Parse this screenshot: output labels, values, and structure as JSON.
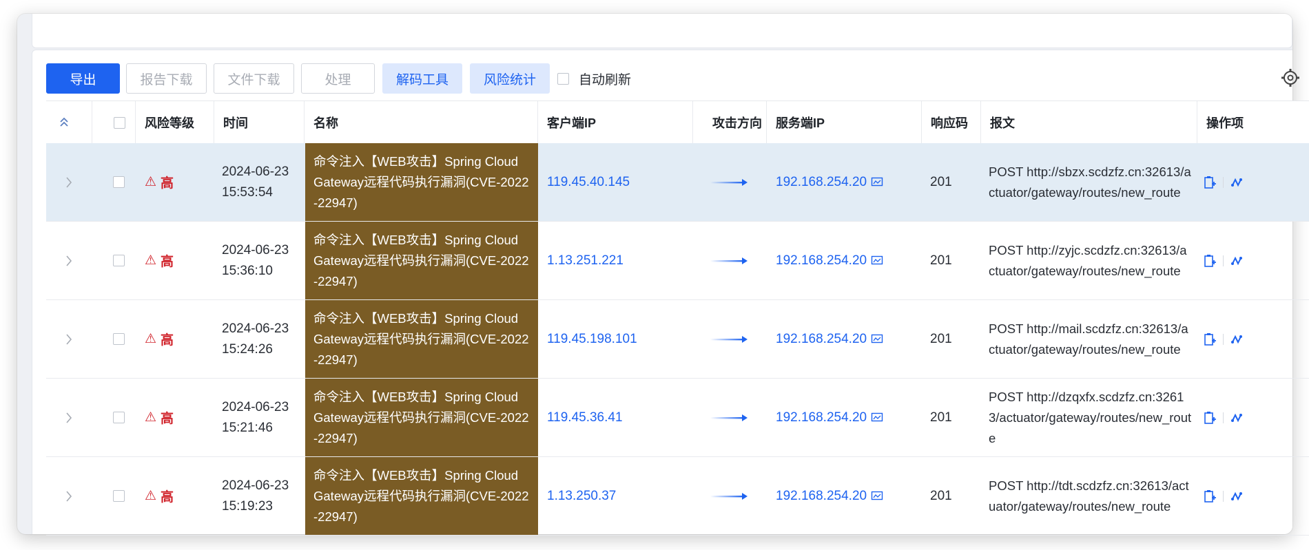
{
  "toolbar": {
    "export_label": "导出",
    "report_download_label": "报告下载",
    "file_download_label": "文件下载",
    "process_label": "处理",
    "decode_tool_label": "解码工具",
    "risk_stats_label": "风险统计",
    "auto_refresh_label": "自动刷新"
  },
  "table": {
    "headers": {
      "risk_level": "风险等级",
      "time": "时间",
      "name": "名称",
      "client_ip": "客户端IP",
      "direction": "攻击方向",
      "server_ip": "服务端IP",
      "response_code": "响应码",
      "message": "报文",
      "actions": "操作项"
    },
    "rows": [
      {
        "risk": "高",
        "time": "2024-06-23 15:53:54",
        "name": "命令注入【WEB攻击】Spring Cloud Gateway远程代码执行漏洞(CVE-2022-22947)",
        "client_ip": "119.45.40.145",
        "server_ip": "192.168.254.20",
        "code": "201",
        "message": "POST http://sbzx.scdzfz.cn:32613/actuator/gateway/routes/new_route"
      },
      {
        "risk": "高",
        "time": "2024-06-23 15:36:10",
        "name": "命令注入【WEB攻击】Spring Cloud Gateway远程代码执行漏洞(CVE-2022-22947)",
        "client_ip": "1.13.251.221",
        "server_ip": "192.168.254.20",
        "code": "201",
        "message": "POST http://zyjc.scdzfz.cn:32613/actuator/gateway/routes/new_route"
      },
      {
        "risk": "高",
        "time": "2024-06-23 15:24:26",
        "name": "命令注入【WEB攻击】Spring Cloud Gateway远程代码执行漏洞(CVE-2022-22947)",
        "client_ip": "119.45.198.101",
        "server_ip": "192.168.254.20",
        "code": "201",
        "message": "POST http://mail.scdzfz.cn:32613/actuator/gateway/routes/new_route"
      },
      {
        "risk": "高",
        "time": "2024-06-23 15:21:46",
        "name": "命令注入【WEB攻击】Spring Cloud Gateway远程代码执行漏洞(CVE-2022-22947)",
        "client_ip": "119.45.36.41",
        "server_ip": "192.168.254.20",
        "code": "201",
        "message": "POST http://dzqxfx.scdzfz.cn:32613/actuator/gateway/routes/new_route"
      },
      {
        "risk": "高",
        "time": "2024-06-23 15:19:23",
        "name": "命令注入【WEB攻击】Spring Cloud Gateway远程代码执行漏洞(CVE-2022-22947)",
        "client_ip": "1.13.250.37",
        "server_ip": "192.168.254.20",
        "code": "201",
        "message": "POST http://tdt.scdzfz.cn:32613/actuator/gateway/routes/new_route"
      }
    ]
  },
  "icons": {
    "risk": "warning-triangle-icon",
    "direction": "arrow-right-icon",
    "server": "monitor-icon",
    "action_1": "clipboard-add-icon",
    "action_2": "graph-link-icon",
    "settings": "gear-icon"
  },
  "colors": {
    "primary": "#1e63f0",
    "risk_high": "#d0232b",
    "name_highlight": "#7a5c25",
    "selected_row": "#e2ecf5"
  }
}
